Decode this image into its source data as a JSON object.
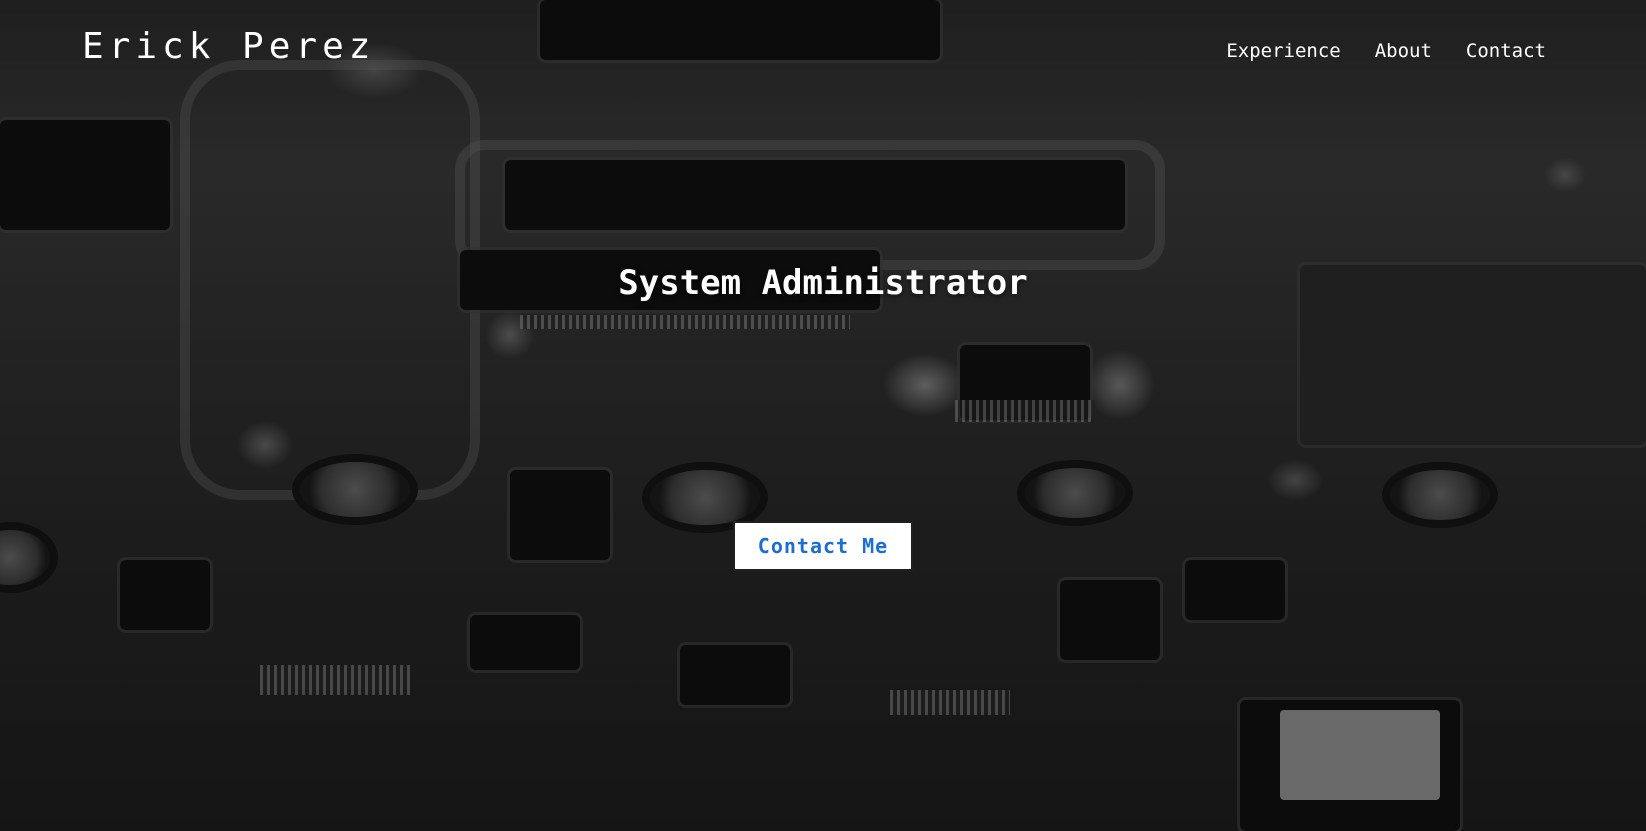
{
  "header": {
    "brand": "Erick Perez"
  },
  "nav": {
    "items": [
      {
        "label": "Experience"
      },
      {
        "label": "About"
      },
      {
        "label": "Contact"
      }
    ]
  },
  "hero": {
    "headline": "System Administrator",
    "cta_label": "Contact Me",
    "background": "grayscale-circuit-board-image"
  },
  "colors": {
    "text": "#ffffff",
    "cta_background": "#ffffff",
    "cta_text": "#1c6fd0"
  }
}
